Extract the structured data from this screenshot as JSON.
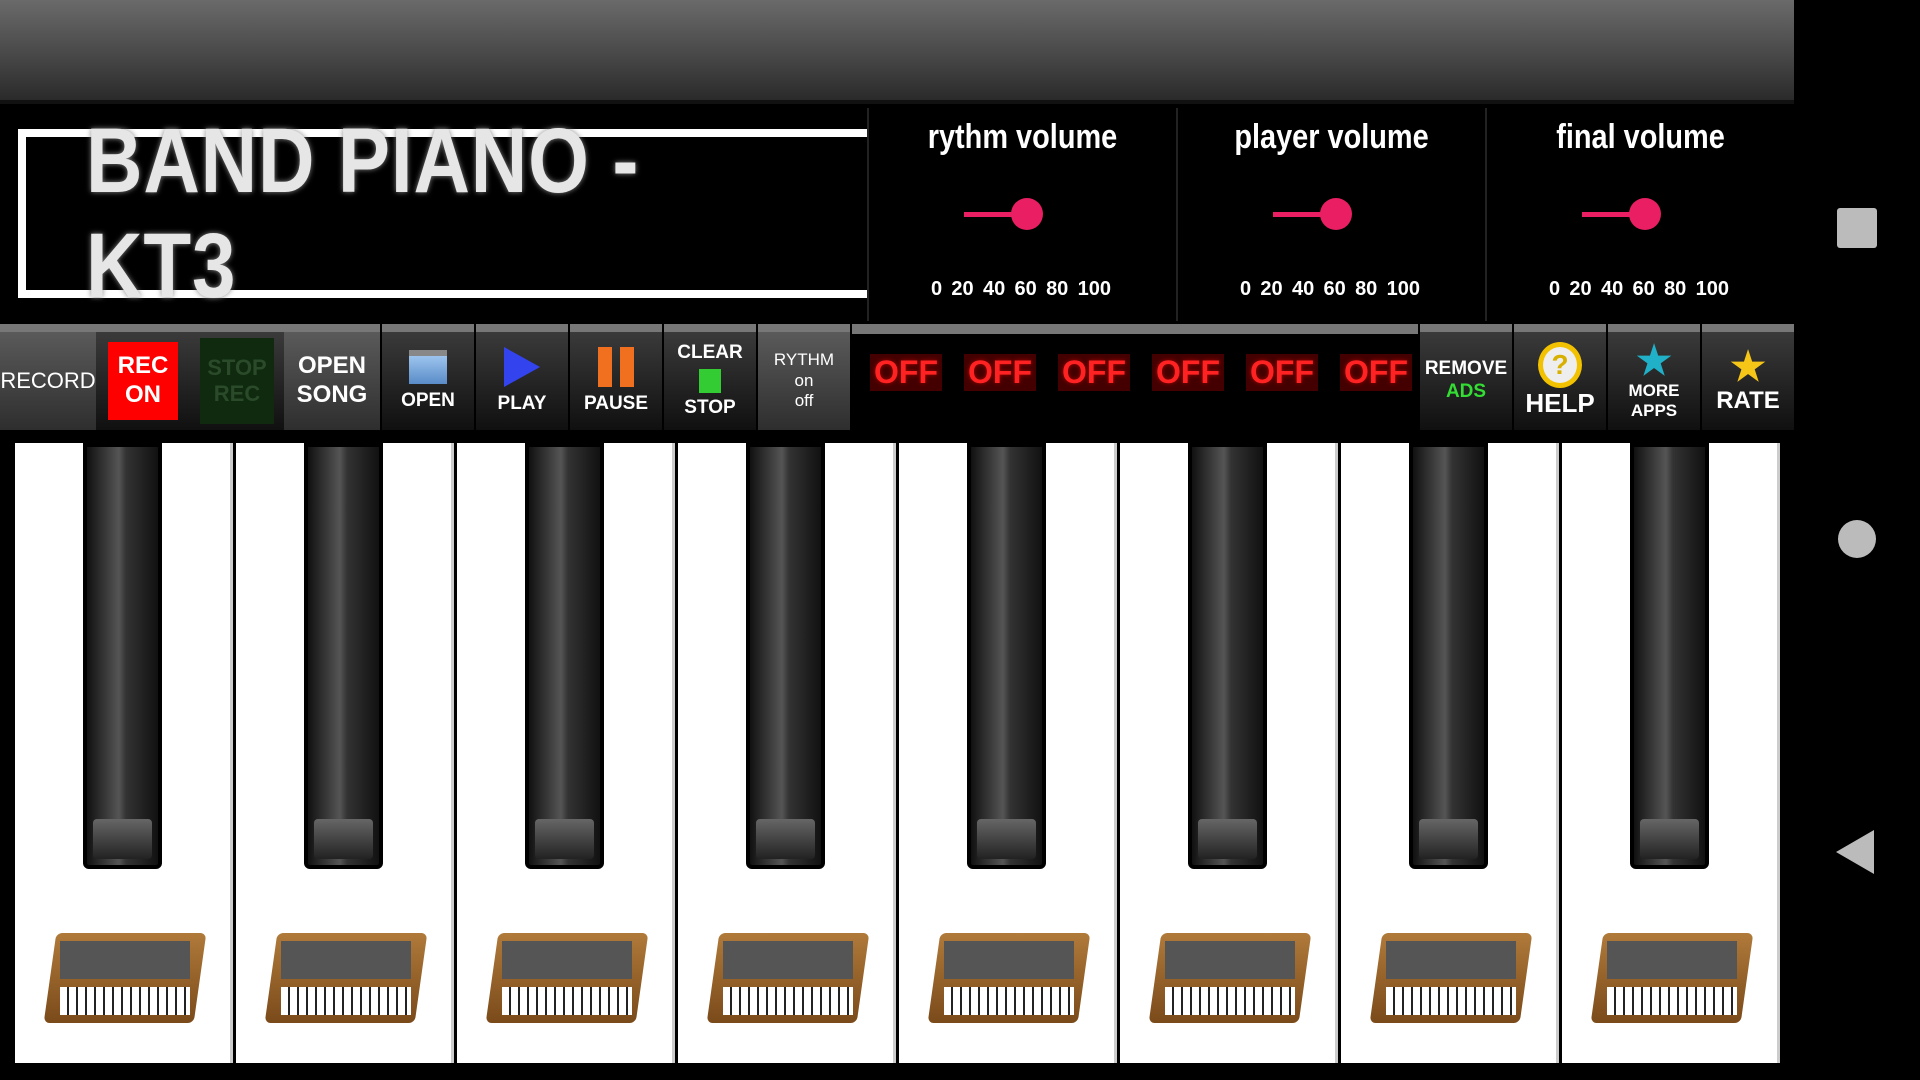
{
  "app": {
    "title": "BAND PIANO - KT3"
  },
  "volumes": [
    {
      "label": "rythm volume",
      "value": 45,
      "ticks": [
        "0",
        "20",
        "40",
        "60",
        "80",
        "100"
      ]
    },
    {
      "label": "player volume",
      "value": 45,
      "ticks": [
        "0",
        "20",
        "40",
        "60",
        "80",
        "100"
      ]
    },
    {
      "label": "final volume",
      "value": 45,
      "ticks": [
        "0",
        "20",
        "40",
        "60",
        "80",
        "100"
      ]
    }
  ],
  "colors": {
    "accent": "#e91e63",
    "rec_on": "#ff0000",
    "stop_rec": "#0f2a0f",
    "off": "#ff2222",
    "ads": "#33dd33"
  },
  "toolbar": {
    "record": "RECORD",
    "rec_on": [
      "REC",
      "ON"
    ],
    "stop_rec": [
      "STOP",
      "REC"
    ],
    "open_song": [
      "OPEN",
      "SONG"
    ],
    "open": "OPEN",
    "play": "PLAY",
    "pause": "PAUSE",
    "clear_stop": [
      "CLEAR",
      "STOP"
    ],
    "rythm": [
      "RYTHM",
      "on",
      "off"
    ],
    "offs": [
      "OFF",
      "OFF",
      "OFF",
      "OFF",
      "OFF",
      "OFF"
    ],
    "remove_ads": [
      "REMOVE",
      "ADS"
    ],
    "help": "HELP",
    "more_apps": [
      "MORE",
      "APPS"
    ],
    "rate": "RATE"
  },
  "icons": {
    "open": "folder-icon",
    "play": "play-icon",
    "pause": "pause-icon",
    "stop": "stop-icon",
    "help": "help-icon",
    "more_apps": "star-icon",
    "rate": "star-icon"
  },
  "keys": {
    "white_count": 8,
    "black_count": 8
  }
}
